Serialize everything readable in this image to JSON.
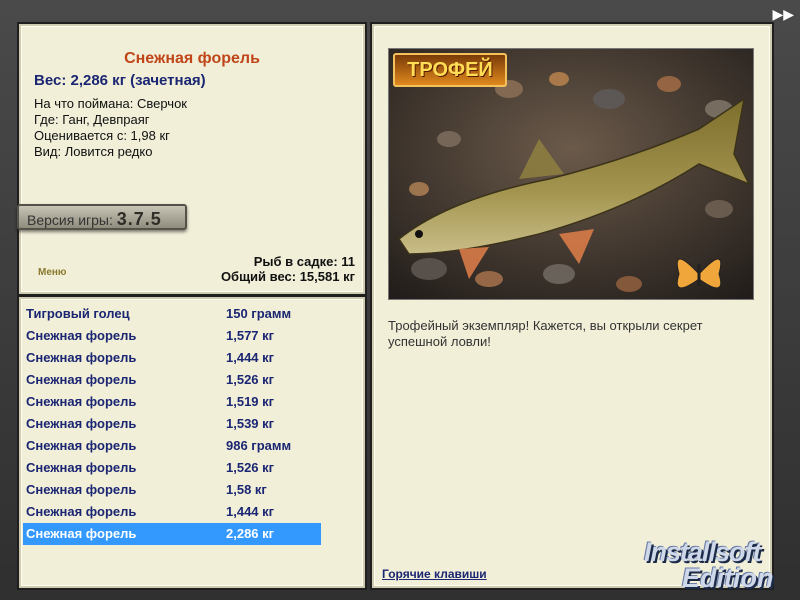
{
  "info": {
    "fish_name": "Снежная форель",
    "weight_line": "Вес: 2,286 кг (зачетная)",
    "bait": "На что поймана: Сверчок",
    "place": "Где: Ганг, Девпраяг",
    "value": "Оценивается с: 1,98 кг",
    "kind": "Вид: Ловится редко",
    "version_label": "Версия игры:",
    "version_number": "3.7.5",
    "menu_label": "Меню",
    "fish_in_keepnet": "Рыб в садке: 11",
    "total_weight": "Общий вес: 15,581 кг"
  },
  "catch_list": [
    {
      "name": "Тигровый голец",
      "weight": "150 грамм"
    },
    {
      "name": "Снежная форель",
      "weight": "1,577 кг"
    },
    {
      "name": "Снежная форель",
      "weight": "1,444 кг"
    },
    {
      "name": "Снежная форель",
      "weight": "1,526 кг"
    },
    {
      "name": "Снежная форель",
      "weight": "1,519 кг"
    },
    {
      "name": "Снежная форель",
      "weight": "1,539 кг"
    },
    {
      "name": "Снежная форель",
      "weight": "986 грамм"
    },
    {
      "name": "Снежная форель",
      "weight": "1,526 кг"
    },
    {
      "name": "Снежная форель",
      "weight": "1,58 кг"
    },
    {
      "name": "Снежная форель",
      "weight": "1,444 кг"
    },
    {
      "name": "Снежная форель",
      "weight": "2,286 кг"
    }
  ],
  "selected_index": 10,
  "right": {
    "trophy_badge": "ТРОФЕЙ",
    "message": "Трофейный экземпляр! Кажется, вы открыли секрет успешной ловли!",
    "hotkeys_link": "Горячие клавиши"
  },
  "top_button": "▶▶",
  "watermark": {
    "line1": "Installsoft",
    "line2": "Edition"
  },
  "colors": {
    "panel_bg": "#f1efd8",
    "title_orange": "#c0461a",
    "navy_text": "#1b2673",
    "selection_blue": "#3399ff"
  },
  "icons": {
    "fast_forward": "fast-forward-icon",
    "fish_photo": "trout-photo",
    "butterfly": "butterfly-icon"
  }
}
